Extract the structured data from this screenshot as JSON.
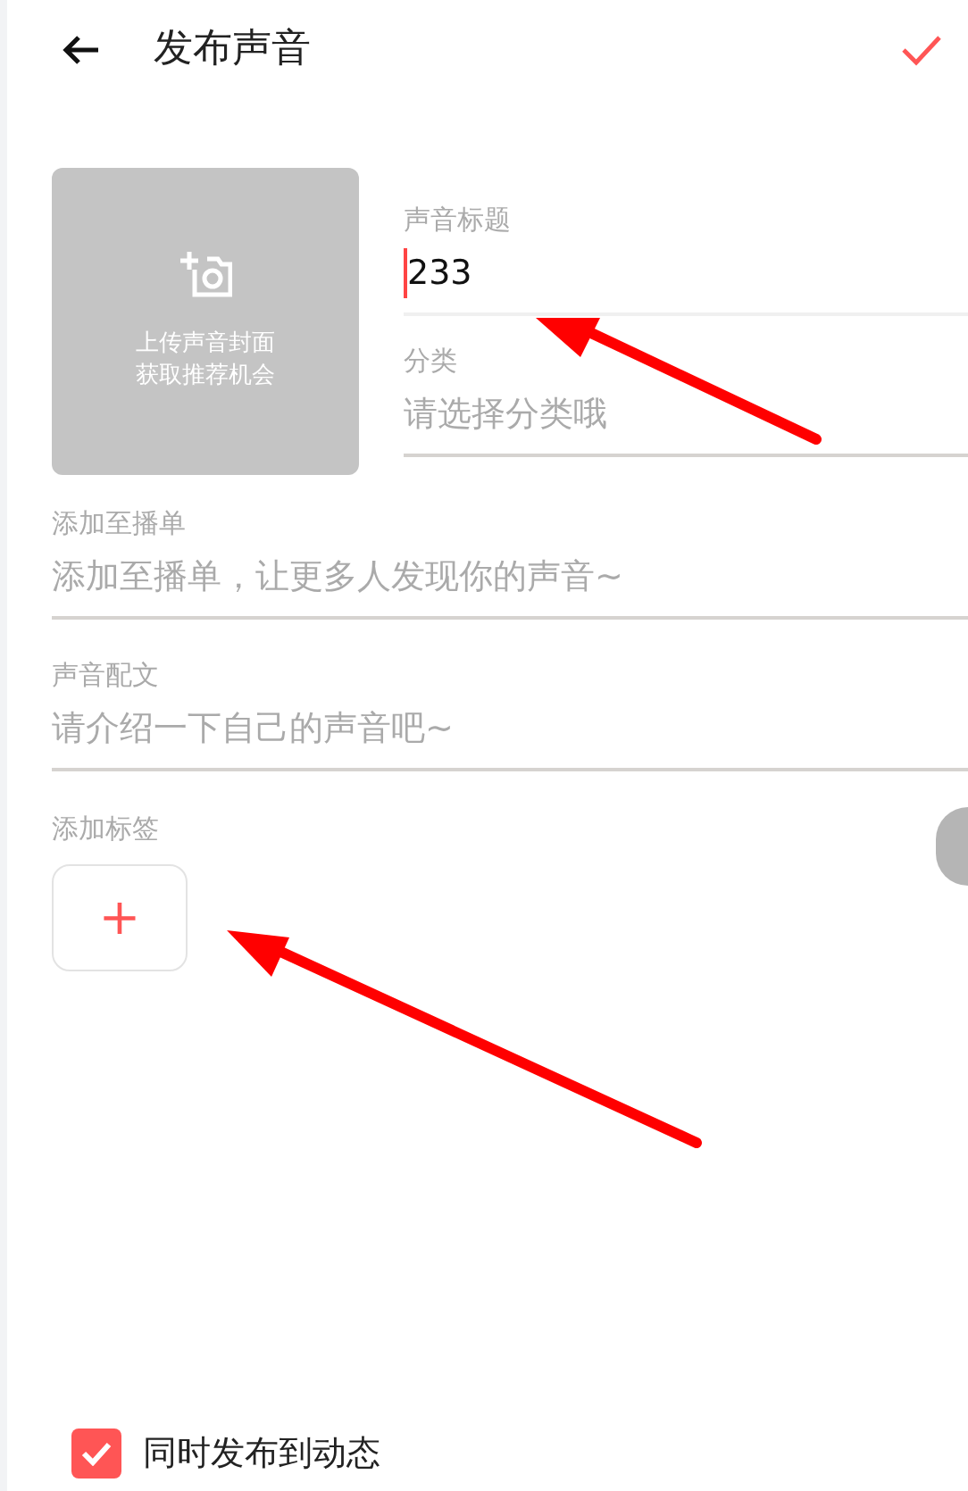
{
  "header": {
    "title": "发布声音"
  },
  "cover": {
    "lines": [
      "上传声音封面",
      "获取推荐机会"
    ]
  },
  "top_fields": [
    {
      "label": "声音标题",
      "value": "233",
      "focused": true
    },
    {
      "label": "分类",
      "placeholder": "请选择分类哦",
      "focused": false
    }
  ],
  "fields": [
    {
      "label": "添加至播单",
      "placeholder": "添加至播单，让更多人发现你的声音~"
    },
    {
      "label": "声音配文",
      "placeholder": "请介绍一下自己的声音吧~"
    }
  ],
  "tags": {
    "label": "添加标签",
    "add": "+"
  },
  "sync": {
    "label": "同时发布到动态",
    "checked": true
  }
}
